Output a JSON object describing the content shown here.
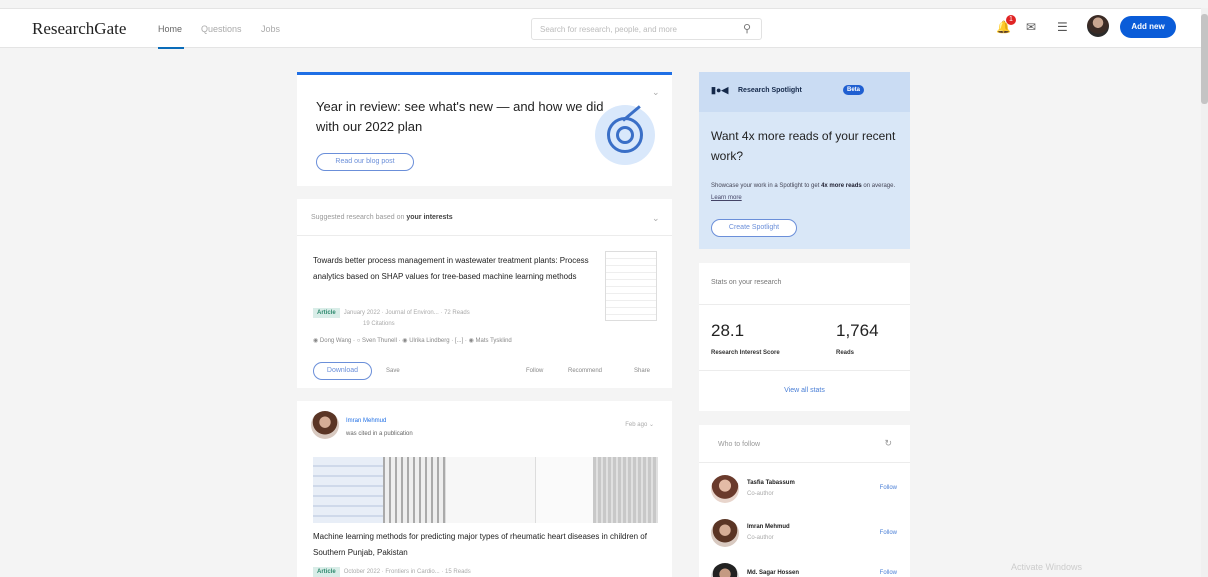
{
  "header": {
    "logo": "ResearchGate",
    "nav": [
      "Home",
      "Questions",
      "Jobs"
    ],
    "search_placeholder": "Search for research, people, and more",
    "notification_count": "1",
    "add_new_label": "Add new"
  },
  "year_card": {
    "title": "Year in review: see what's new — and how we did with our 2022 plan",
    "button": "Read our blog post"
  },
  "suggested": {
    "intro": "Suggested research based on ",
    "intro_bold": "your interests",
    "paper_title": "Towards better process management in wastewater treatment plants: Process analytics based on SHAP values for tree-based machine learning methods",
    "tag": "Article",
    "meta_line1": "January 2022 · Journal of Environ... · 72 Reads",
    "meta_line2": "19 Citations",
    "authors": [
      "Dong Wang",
      "Sven Thunell",
      "Ulrika Lindberg",
      "[...]",
      "Mats Tysklind"
    ],
    "download": "Download",
    "save": "Save",
    "follow": "Follow",
    "recommend": "Recommend",
    "share": "Share"
  },
  "feed": {
    "name": "Imran Mehmud",
    "action": "was cited in a publication",
    "time": "Feb ago",
    "title": "Machine learning methods for predicting major types of rheumatic heart diseases in children of Southern Punjab, Pakistan",
    "tag": "Article",
    "meta": "October 2022 · Frontiers in Cardio... · 15 Reads"
  },
  "spotlight": {
    "logo": "▮●◀",
    "title": "Research Spotlight",
    "beta": "Beta",
    "headline": "Want 4x more reads of your recent work?",
    "desc_pre": "Showcase your work in a Spotlight to get ",
    "desc_bold": "4x more reads",
    "desc_mid": " on average. ",
    "desc_link": "Learn more",
    "button": "Create Spotlight"
  },
  "stats": {
    "heading": "Stats on your research",
    "score_value": "28.1",
    "score_label": "Research Interest Score",
    "reads_value": "1,764",
    "reads_label": "Reads",
    "view_all": "View all stats"
  },
  "who_to_follow": {
    "heading": "Who to follow",
    "people": [
      {
        "name": "Tasfia Tabassum",
        "role": "Co-author",
        "button": "Follow"
      },
      {
        "name": "Imran Mehmud",
        "role": "Co-author",
        "button": "Follow"
      },
      {
        "name": "Md. Sagar Hossen",
        "role": "",
        "button": "Follow"
      }
    ]
  },
  "watermark": "Activate Windows"
}
